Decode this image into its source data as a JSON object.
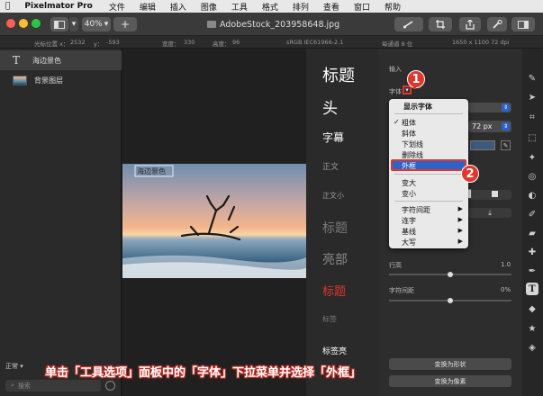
{
  "menubar": {
    "apple": "",
    "app_name": "Pixelmator Pro",
    "items": [
      "文件",
      "编辑",
      "插入",
      "图像",
      "工具",
      "格式",
      "排列",
      "查看",
      "窗口",
      "帮助"
    ]
  },
  "toolbar": {
    "zoom": "40%",
    "add": "+",
    "doc_title": "AdobeStock_203958648.jpg"
  },
  "infobar": {
    "cursor_label": "光标位置 x：",
    "cursor_x": "2532",
    "cursor_y_label": "y：",
    "cursor_y": "-593",
    "width_label": "宽度：",
    "width": "330",
    "height_label": "高度：",
    "height": "96",
    "color_profile": "sRGB IEC61966-2.1",
    "bit_depth": "每通道 8 位",
    "size": "1650 x 1100 72 dpi"
  },
  "layers": [
    {
      "name": "海边景色",
      "kind": "text",
      "selected": true
    },
    {
      "name": "背景图层",
      "kind": "image",
      "selected": false
    }
  ],
  "sidebar": {
    "blend_mode": "正常",
    "search_placeholder": "搜索"
  },
  "canvas": {
    "text_layer_label": "海边景色"
  },
  "presets": [
    {
      "label": "标题",
      "color": "#ffffff"
    },
    {
      "label": "头",
      "color": "#ffffff"
    },
    {
      "label": "字幕",
      "color": "#ffffff"
    },
    {
      "label": "正文",
      "color": "#9a9a9a"
    },
    {
      "label": "正文小",
      "color": "#9a9a9a"
    },
    {
      "label": "标题",
      "color": "#7a7a7a"
    },
    {
      "label": "亮部",
      "color": "#8a8a8a"
    },
    {
      "label": "标题",
      "color": "#e0362c"
    },
    {
      "label": "标签",
      "color": "#7a7a7a"
    },
    {
      "label": "标签亮",
      "color": "#ffffff"
    }
  ],
  "options": {
    "input_label": "输入",
    "font_label": "字体",
    "font_size": "72 px",
    "line_height_label": "行高",
    "line_height_value": "1.0",
    "char_spacing_label": "字符间距",
    "char_spacing_value": "0%",
    "convert_shape": "变换为形状",
    "convert_pixels": "变换为像素"
  },
  "font_menu": {
    "header": "显示字体",
    "items": [
      {
        "label": "粗体",
        "checked": true,
        "submenu": false
      },
      {
        "label": "斜体",
        "checked": false,
        "submenu": false
      },
      {
        "label": "下划线",
        "checked": false,
        "submenu": false
      },
      {
        "label": "删除线",
        "checked": false,
        "submenu": false
      },
      {
        "label": "外框",
        "checked": false,
        "submenu": false,
        "highlighted": true
      },
      {
        "label": "变大",
        "checked": false,
        "submenu": false
      },
      {
        "label": "变小",
        "checked": false,
        "submenu": false
      },
      {
        "label": "字符间距",
        "checked": false,
        "submenu": true
      },
      {
        "label": "连字",
        "checked": false,
        "submenu": true
      },
      {
        "label": "基线",
        "checked": false,
        "submenu": true
      },
      {
        "label": "大写",
        "checked": false,
        "submenu": true
      }
    ]
  },
  "callouts": [
    "1",
    "2"
  ],
  "caption": "单击「工具选项」面板中的「字体」下拉菜单并选择「外框」",
  "colors": {
    "accent": "#e0362c",
    "highlight": "#2d63c8"
  }
}
